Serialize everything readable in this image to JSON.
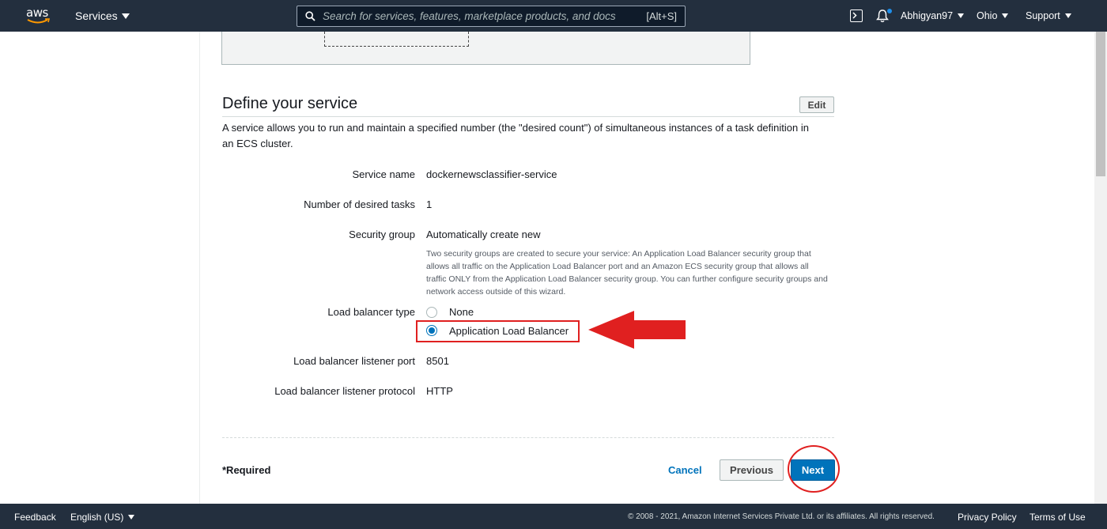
{
  "nav": {
    "logo_text": "aws",
    "services": "Services",
    "search_placeholder": "Search for services, features, marketplace products, and docs",
    "search_shortcut": "[Alt+S]",
    "user": "Abhigyan97",
    "region": "Ohio",
    "support": "Support"
  },
  "section": {
    "title": "Define your service",
    "edit_label": "Edit",
    "description": "A service allows you to run and maintain a specified number (the \"desired count\") of simultaneous instances of a task definition in an ECS cluster."
  },
  "fields": {
    "service_name_label": "Service name",
    "service_name_value": "dockernewsclassifier-service",
    "desired_tasks_label": "Number of desired tasks",
    "desired_tasks_value": "1",
    "security_group_label": "Security group",
    "security_group_value": "Automatically create new",
    "security_group_help": "Two security groups are created to secure your service: An Application Load Balancer security group that allows all traffic on the Application Load Balancer port and an Amazon ECS security group that allows all traffic ONLY from the Application Load Balancer security group. You can further configure security groups and network access outside of this wizard.",
    "lb_type_label": "Load balancer type",
    "lb_options": [
      "None",
      "Application Load Balancer"
    ],
    "lb_selected": "Application Load Balancer",
    "listener_port_label": "Load balancer listener port",
    "listener_port_value": "8501",
    "listener_protocol_label": "Load balancer listener protocol",
    "listener_protocol_value": "HTTP"
  },
  "actions": {
    "required": "*Required",
    "cancel": "Cancel",
    "previous": "Previous",
    "next": "Next"
  },
  "footer": {
    "feedback": "Feedback",
    "language": "English (US)",
    "copyright": "© 2008 - 2021, Amazon Internet Services Private Ltd. or its affiliates. All rights reserved.",
    "privacy": "Privacy Policy",
    "terms": "Terms of Use"
  },
  "colors": {
    "nav_bg": "#232f3e",
    "primary": "#0073bb",
    "annotation_red": "#e02020"
  }
}
